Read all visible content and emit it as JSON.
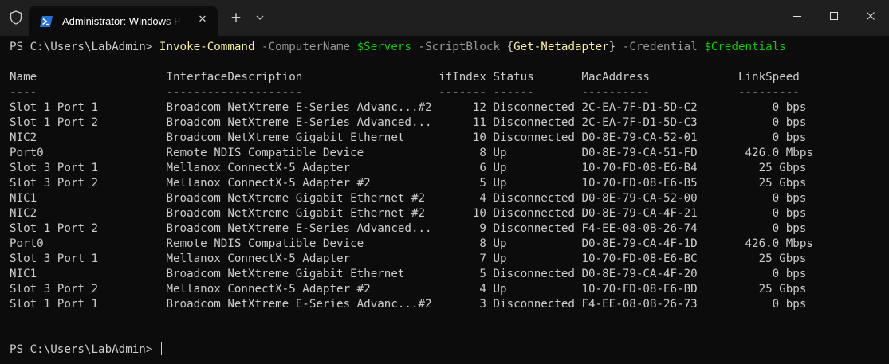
{
  "window": {
    "tab_title": "Administrator: Windows PowerShell",
    "new_tab_label": "+",
    "close_tab_label": "✕"
  },
  "command": {
    "prompt": "PS C:\\Users\\LabAdmin> ",
    "cmdlet": "Invoke-Command",
    "param1": " -ComputerName ",
    "var1": "$Servers",
    "param2": " -ScriptBlock ",
    "brace_open": "{",
    "inner_cmd": "Get-Netadapter",
    "brace_close": "}",
    "param3": " -Credential ",
    "var2": "$Credentials"
  },
  "table": {
    "header": "Name                   InterfaceDescription                    ifIndex Status       MacAddress             LinkSpeed",
    "separator": "----                   --------------------                    ------- ------       ----------             ---------",
    "rows": [
      "Slot 1 Port 1          Broadcom NetXtreme E-Series Advanc...#2      12 Disconnected 2C-EA-7F-D1-5D-C2           0 bps",
      "Slot 1 Port 2          Broadcom NetXtreme E-Series Advanced...      11 Disconnected 2C-EA-7F-D1-5D-C3           0 bps",
      "NIC2                   Broadcom NetXtreme Gigabit Ethernet          10 Disconnected D0-8E-79-CA-52-01           0 bps",
      "Port0                  Remote NDIS Compatible Device                 8 Up           D0-8E-79-CA-51-FD       426.0 Mbps",
      "Slot 3 Port 1          Mellanox ConnectX-5 Adapter                   6 Up           10-70-FD-08-E6-B4         25 Gbps",
      "Slot 3 Port 2          Mellanox ConnectX-5 Adapter #2                5 Up           10-70-FD-08-E6-B5         25 Gbps",
      "NIC1                   Broadcom NetXtreme Gigabit Ethernet #2        4 Disconnected D0-8E-79-CA-52-00           0 bps",
      "NIC2                   Broadcom NetXtreme Gigabit Ethernet #2       10 Disconnected D0-8E-79-CA-4F-21           0 bps",
      "Slot 1 Port 2          Broadcom NetXtreme E-Series Advanced...       9 Disconnected F4-EE-08-0B-26-74           0 bps",
      "Port0                  Remote NDIS Compatible Device                 8 Up           D0-8E-79-CA-4F-1D       426.0 Mbps",
      "Slot 3 Port 1          Mellanox ConnectX-5 Adapter                   7 Up           10-70-FD-08-E6-BC         25 Gbps",
      "NIC1                   Broadcom NetXtreme Gigabit Ethernet           5 Disconnected D0-8E-79-CA-4F-20           0 bps",
      "Slot 3 Port 2          Mellanox ConnectX-5 Adapter #2                4 Up           10-70-FD-08-E6-BD         25 Gbps",
      "Slot 1 Port 1          Broadcom NetXtreme E-Series Advanc...#2       3 Disconnected F4-EE-08-0B-26-73           0 bps"
    ]
  },
  "final_prompt": "PS C:\\Users\\LabAdmin> ",
  "colors": {
    "background": "#0c0c0c",
    "titlebar": "#1f1f1f",
    "text": "#cccccc",
    "cmdlet": "#f9f1a5",
    "parameter": "#9a9a9a",
    "variable": "#16c60c"
  },
  "icons": {
    "shield": "shield-icon",
    "powershell": "powershell-icon",
    "close_tab": "close-icon",
    "new_tab": "plus-icon",
    "dropdown": "chevron-down-icon",
    "minimize": "minimize-icon",
    "maximize": "maximize-icon",
    "close_window": "close-icon"
  }
}
